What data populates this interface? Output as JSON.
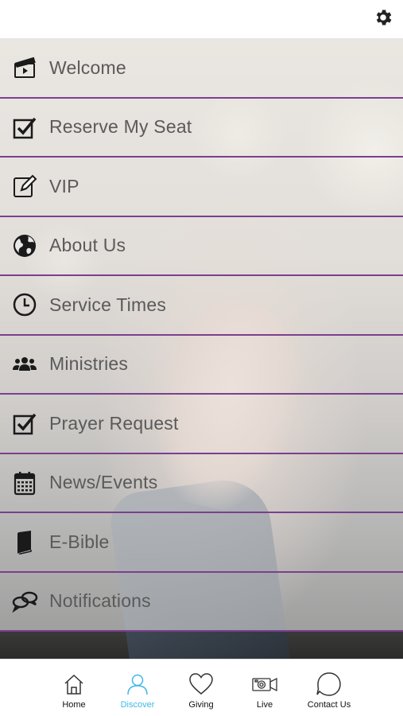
{
  "colors": {
    "divider": "#7b3f8f",
    "tab_active": "#3fb8e6",
    "label": "#5a5a5a"
  },
  "topbar": {
    "settings_icon": "gear-icon"
  },
  "menu": {
    "items": [
      {
        "label": "Welcome",
        "icon": "clapperboard-icon"
      },
      {
        "label": "Reserve My Seat",
        "icon": "checkbox-icon"
      },
      {
        "label": "VIP",
        "icon": "edit-pencil-icon"
      },
      {
        "label": "About Us",
        "icon": "globe-icon"
      },
      {
        "label": "Service Times",
        "icon": "clock-icon"
      },
      {
        "label": "Ministries",
        "icon": "people-icon"
      },
      {
        "label": "Prayer Request",
        "icon": "checkbox-icon"
      },
      {
        "label": "News/Events",
        "icon": "calendar-icon"
      },
      {
        "label": "E-Bible",
        "icon": "book-icon"
      },
      {
        "label": "Notifications",
        "icon": "chat-bubbles-icon"
      }
    ]
  },
  "tabbar": {
    "tabs": [
      {
        "label": "Home",
        "icon": "home-icon",
        "active": false
      },
      {
        "label": "Discover",
        "icon": "person-icon",
        "active": true
      },
      {
        "label": "Giving",
        "icon": "heart-icon",
        "active": false
      },
      {
        "label": "Live",
        "icon": "video-camera-icon",
        "active": false
      },
      {
        "label": "Contact Us",
        "icon": "speech-bubble-icon",
        "active": false
      }
    ]
  }
}
